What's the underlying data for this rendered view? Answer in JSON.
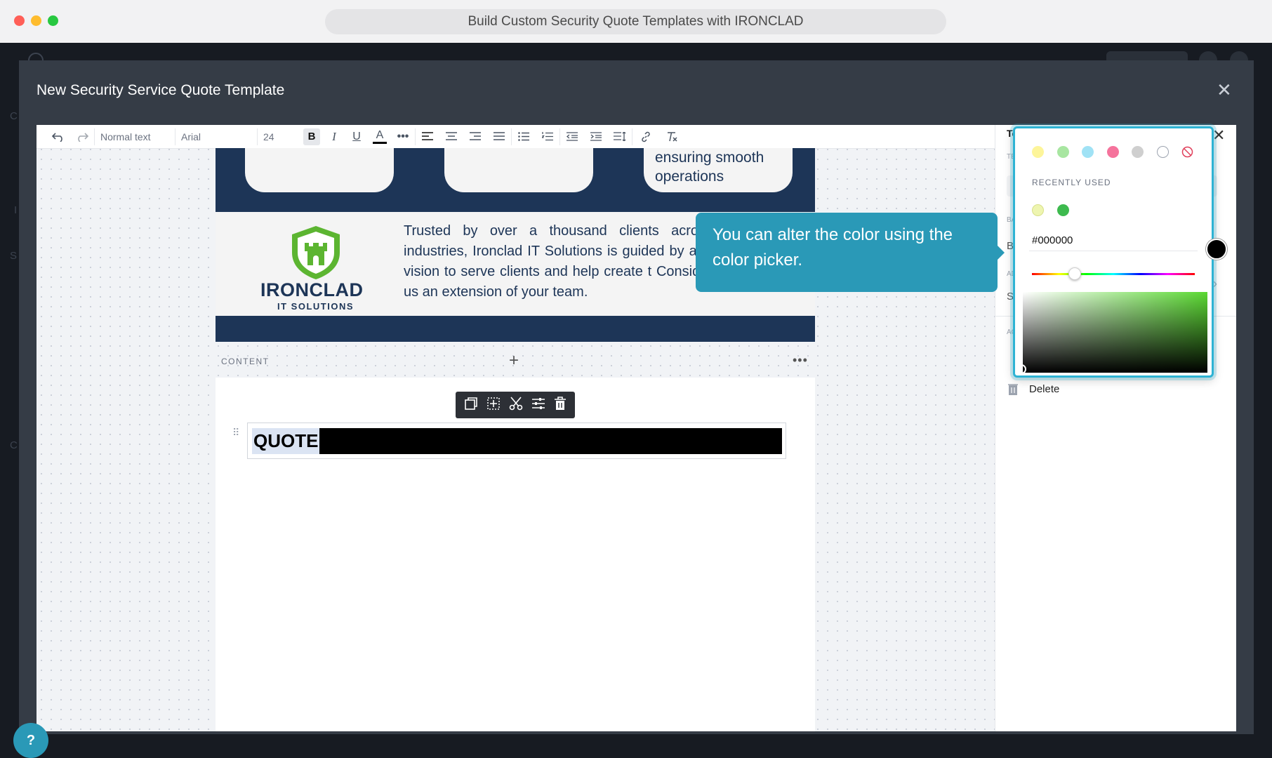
{
  "browser": {
    "title": "Build Custom Security Quote Templates with IRONCLAD",
    "controls": {
      "close_color": "#ff5f57",
      "minimize_color": "#febc2e",
      "maximize_color": "#28c840"
    }
  },
  "modal": {
    "title": "New Security Service Quote Template",
    "close_icon": "close-icon"
  },
  "toolbar": {
    "paragraph_style": "Normal text",
    "font_family": "Arial",
    "font_size": "24",
    "icons": [
      "undo-icon",
      "redo-icon",
      "bold-icon",
      "italic-icon",
      "underline-icon",
      "text-color-icon",
      "more-icon",
      "align-left-icon",
      "align-center-icon",
      "align-right-icon",
      "align-justify-icon",
      "bullet-list-icon",
      "numbered-list-icon",
      "outdent-icon",
      "indent-icon",
      "line-height-icon",
      "link-icon",
      "clear-format-icon"
    ]
  },
  "page": {
    "card_text": "ensuring smooth operations",
    "logo_name": "IRONCLAD",
    "logo_sub": "IT SOLUTIONS",
    "about_text": "Trusted by over a thousand clients across industries, Ironclad IT Solutions is guided by and vision to serve clients and help create t Consider us an extension of your team.",
    "content_label": "CONTENT",
    "quote_text": "QUOTE",
    "colors": {
      "navy": "#1d3557",
      "brand_green": "#5cb531",
      "quote_bg": "#000000"
    }
  },
  "block_toolbar": {
    "icons": [
      "duplicate-icon",
      "add-block-icon",
      "cut-icon",
      "settings-icon",
      "trash-icon"
    ]
  },
  "right_panel": {
    "title": "Text",
    "delete_label": "Delete"
  },
  "color_picker": {
    "swatches": [
      "#fdf59a",
      "#a8e6a1",
      "#a0e2f5",
      "#f5739c",
      "#cfcfcf",
      "#ffffff",
      "none"
    ],
    "recently_used_label": "RECENTLY USED",
    "recent": [
      "#eef5b0",
      "#3dba4e"
    ],
    "hex_value": "#000000",
    "accent": "#2eb3d4"
  },
  "tooltip": {
    "text": "You can alter the color using the color picker."
  },
  "help": {
    "label": "?"
  }
}
